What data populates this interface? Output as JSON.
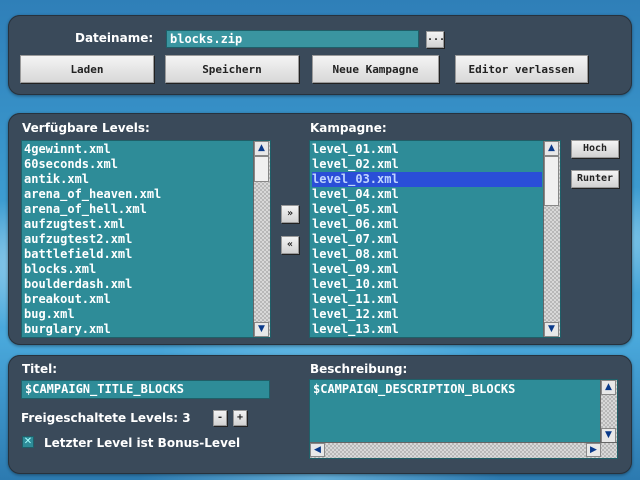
{
  "file": {
    "filename_label": "Dateiname:",
    "filename_value": "blocks.zip",
    "browse_label": "...",
    "buttons": {
      "load": "Laden",
      "save": "Speichern",
      "new_campaign": "Neue Kampagne",
      "exit_editor": "Editor verlassen"
    }
  },
  "levels": {
    "available_label": "Verfügbare Levels:",
    "available": [
      "4gewinnt.xml",
      "60seconds.xml",
      "antik.xml",
      "arena_of_heaven.xml",
      "arena_of_hell.xml",
      "aufzugtest.xml",
      "aufzugtest2.xml",
      "battlefield.xml",
      "blocks.xml",
      "boulderdash.xml",
      "breakout.xml",
      "bug.xml",
      "burglary.xml"
    ],
    "add_label": "»",
    "remove_label": "«",
    "campaign_label": "Kampagne:",
    "campaign": [
      "level_01.xml",
      "level_02.xml",
      "level_03.xml",
      "level_04.xml",
      "level_05.xml",
      "level_06.xml",
      "level_07.xml",
      "level_08.xml",
      "level_09.xml",
      "level_10.xml",
      "level_11.xml",
      "level_12.xml",
      "level_13.xml"
    ],
    "campaign_selected_index": 2,
    "up_label": "Hoch",
    "down_label": "Runter"
  },
  "details": {
    "title_label": "Titel:",
    "title_value": "$CAMPAIGN_TITLE_BLOCKS",
    "unlocked_label": "Freigeschaltete Levels: 3",
    "minus_label": "-",
    "plus_label": "+",
    "bonus_checked": true,
    "check_mark": "✕",
    "bonus_label": "Letzter Level ist Bonus-Level",
    "description_label": "Beschreibung:",
    "description_value": "$CAMPAIGN_DESCRIPTION_BLOCKS"
  },
  "scroll_glyphs": {
    "up": "▲",
    "down": "▼",
    "left": "◀",
    "right": "▶"
  }
}
